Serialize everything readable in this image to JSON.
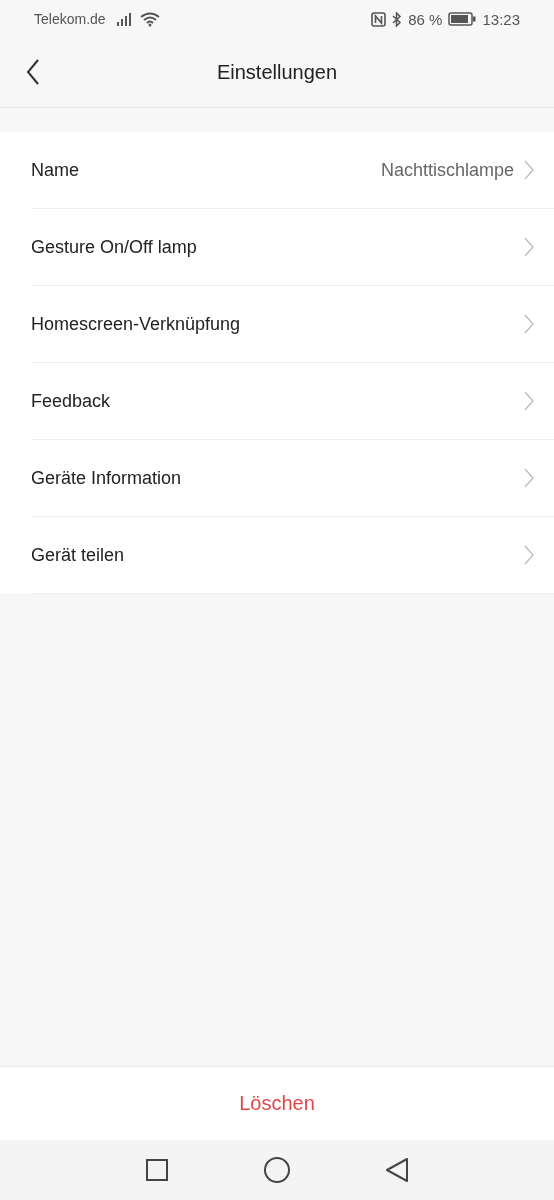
{
  "status_bar": {
    "carrier": "Telekom.de",
    "battery": "86 %",
    "time": "13:23"
  },
  "header": {
    "title": "Einstellungen"
  },
  "rows": [
    {
      "label": "Name",
      "value": "Nachttischlampe"
    },
    {
      "label": "Gesture On/Off lamp"
    },
    {
      "label": "Homescreen-Verknüpfung"
    },
    {
      "label": "Feedback"
    },
    {
      "label": "Geräte Information"
    },
    {
      "label": "Gerät teilen"
    }
  ],
  "delete_button": "Löschen"
}
